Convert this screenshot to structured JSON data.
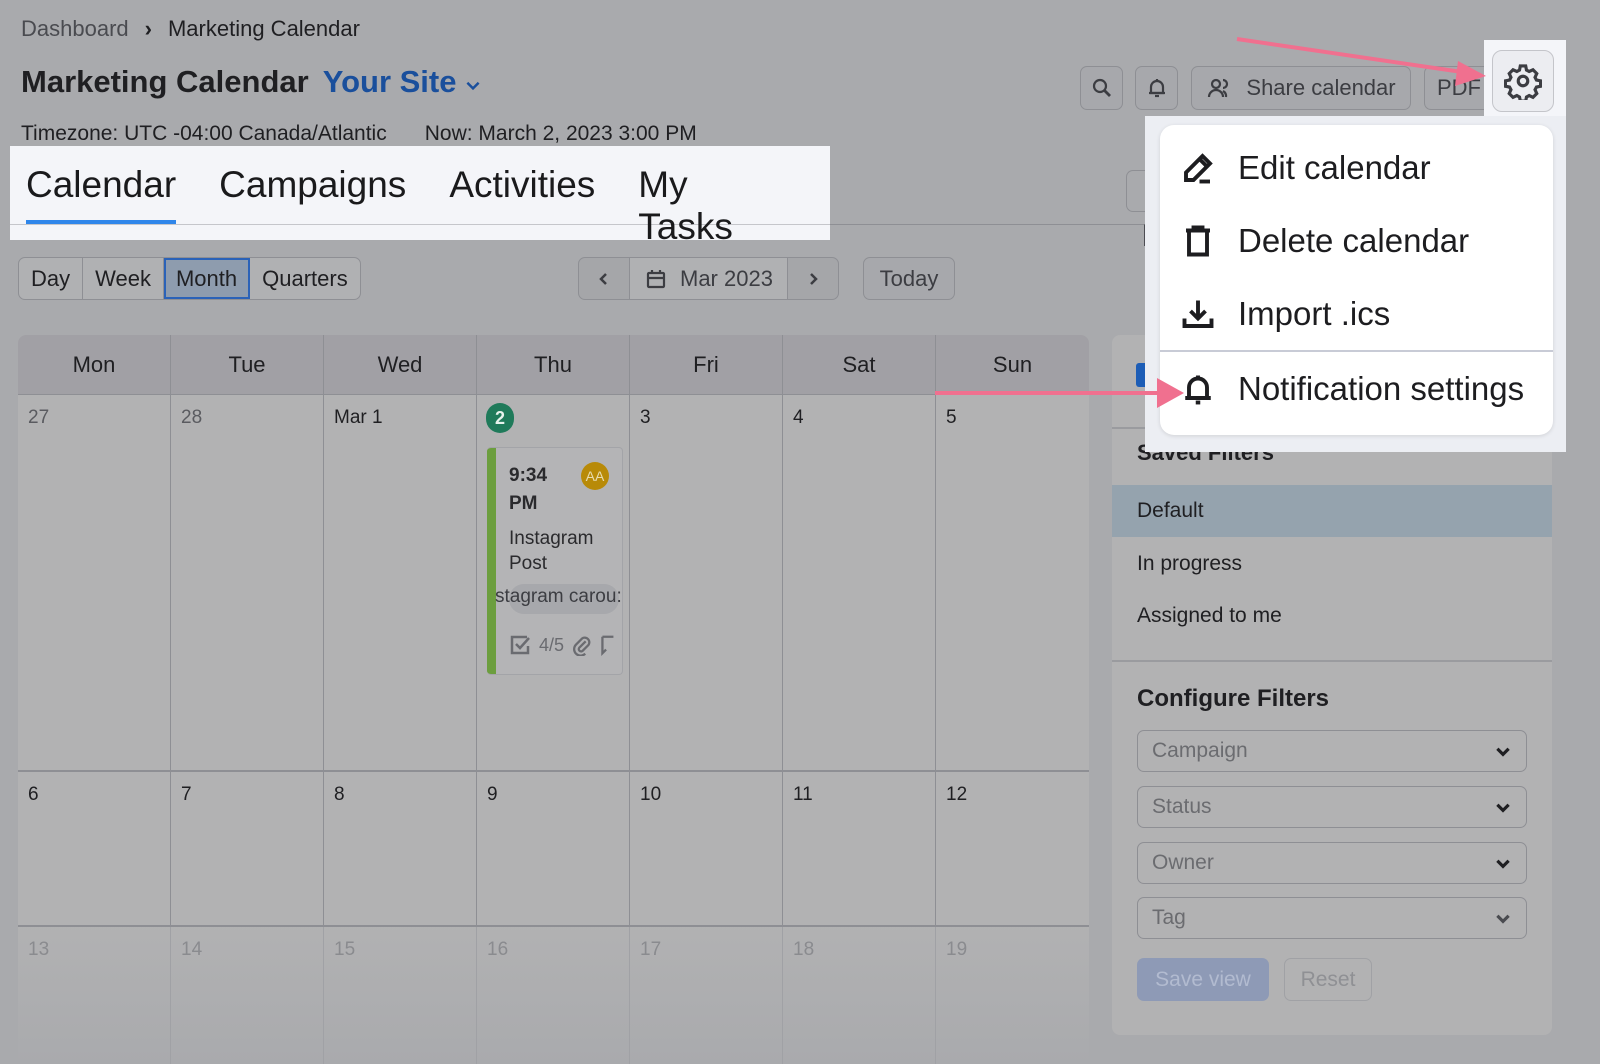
{
  "breadcrumb": {
    "items": [
      "Dashboard",
      "Marketing Calendar"
    ]
  },
  "header": {
    "title": "Marketing Calendar",
    "site": "Your Site",
    "timezone": "Timezone: UTC -04:00 Canada/Atlantic",
    "now": "Now: March 2, 2023 3:00 PM"
  },
  "tabs": [
    {
      "label": "Calendar",
      "active": true
    },
    {
      "label": "Campaigns",
      "active": false
    },
    {
      "label": "Activities",
      "active": false
    },
    {
      "label": "My Tasks",
      "active": false
    }
  ],
  "toolbar": {
    "search_icon": "search-icon",
    "bell_icon": "bell-icon",
    "share_label": "Share calendar",
    "pdf_label": "PDF",
    "settings_icon": "gear-icon"
  },
  "settings_menu": {
    "items": [
      {
        "label": "Edit calendar",
        "icon": "pencil-icon"
      },
      {
        "label": "Delete calendar",
        "icon": "trash-icon"
      },
      {
        "label": "Import .ics",
        "icon": "download-icon"
      },
      {
        "label": "Notification settings",
        "icon": "bell-icon"
      }
    ]
  },
  "view_switch": {
    "options": [
      "Day",
      "Week",
      "Month",
      "Quarters"
    ],
    "selected": "Month"
  },
  "date_nav": {
    "current": "Mar 2023",
    "today_label": "Today"
  },
  "calendar": {
    "weekdays": [
      "Mon",
      "Tue",
      "Wed",
      "Thu",
      "Fri",
      "Sat",
      "Sun"
    ],
    "weeks": [
      [
        "27",
        "28",
        "Mar 1",
        "2",
        "3",
        "4",
        "5"
      ],
      [
        "6",
        "7",
        "8",
        "9",
        "10",
        "11",
        "12"
      ],
      [
        "13",
        "14",
        "15",
        "16",
        "17",
        "18",
        "19"
      ]
    ],
    "today": "2",
    "event": {
      "time": "9:34 PM",
      "avatar": "AA",
      "title": "Instagram Post",
      "tag": "Instagram carousel",
      "tag_visible": "stagram carou:",
      "tasks": "4/5",
      "color": "#6c9e3e"
    }
  },
  "sidebar": {
    "saved_filters_title": "Saved Filters",
    "saved_filters": [
      {
        "label": "Default",
        "active": true
      },
      {
        "label": "In progress",
        "active": false
      },
      {
        "label": "Assigned to me",
        "active": false
      }
    ],
    "configure_title": "Configure Filters",
    "filters": [
      {
        "placeholder": "Campaign"
      },
      {
        "placeholder": "Status"
      },
      {
        "placeholder": "Owner"
      },
      {
        "placeholder": "Tag"
      }
    ],
    "save_view_label": "Save view",
    "reset_label": "Reset"
  },
  "colors": {
    "accent_blue": "#2f86ea",
    "site_blue": "#1a4f9c",
    "today_green": "#1f7a5a",
    "annotation_pink": "#f0708f"
  }
}
